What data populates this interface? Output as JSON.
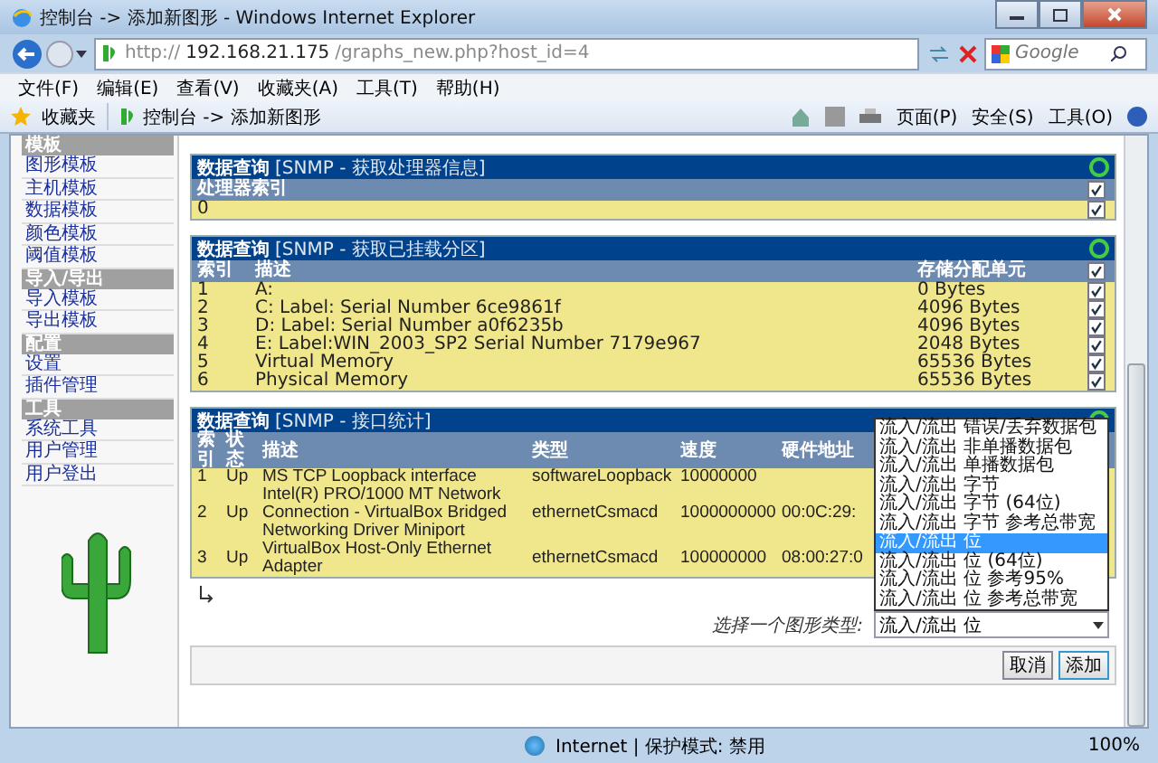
{
  "window": {
    "title": "控制台 -> 添加新图形 - Windows Internet Explorer"
  },
  "address": {
    "scheme": "http://",
    "host": "192.168.21.175",
    "path": "/graphs_new.php?host_id=4"
  },
  "search": {
    "placeholder": "Google"
  },
  "menu": [
    "文件(F)",
    "编辑(E)",
    "查看(V)",
    "收藏夹(A)",
    "工具(T)",
    "帮助(H)"
  ],
  "favorites": {
    "label": "收藏夹",
    "tab": "控制台 -> 添加新图形"
  },
  "toolbar": [
    "页面(P)",
    "安全(S)",
    "工具(O)"
  ],
  "sidebar": [
    {
      "header": "模板",
      "items": [
        "图形模板",
        "主机模板",
        "数据模板",
        "颜色模板",
        "阈值模板"
      ]
    },
    {
      "header": "导入/导出",
      "items": [
        "导入模板",
        "导出模板"
      ]
    },
    {
      "header": "配置",
      "items": [
        "设置",
        "插件管理"
      ]
    },
    {
      "header": "工具",
      "items": [
        "系统工具",
        "用户管理",
        "用户登出"
      ]
    }
  ],
  "panels": [
    {
      "title": "数据查询",
      "subtitle": "[SNMP - 获取处理器信息]",
      "columns": [
        "处理器索引"
      ],
      "header_checked": true,
      "rows": [
        {
          "cells": [
            "0"
          ],
          "checked": true
        }
      ]
    },
    {
      "title": "数据查询",
      "subtitle": "[SNMP - 获取已挂载分区]",
      "columns": [
        "索引",
        "描述",
        "存储分配单元"
      ],
      "header_checked": true,
      "rows": [
        {
          "cells": [
            "1",
            "A:",
            "0 Bytes"
          ],
          "checked": true
        },
        {
          "cells": [
            "2",
            "C: Label: Serial Number 6ce9861f",
            "4096 Bytes"
          ],
          "checked": true
        },
        {
          "cells": [
            "3",
            "D: Label: Serial Number a0f6235b",
            "4096 Bytes"
          ],
          "checked": true
        },
        {
          "cells": [
            "4",
            "E: Label:WIN_2003_SP2 Serial Number 7179e967",
            "2048 Bytes"
          ],
          "checked": true
        },
        {
          "cells": [
            "5",
            "Virtual Memory",
            "65536 Bytes"
          ],
          "checked": true
        },
        {
          "cells": [
            "6",
            "Physical Memory",
            "65536 Bytes"
          ],
          "checked": true
        }
      ]
    },
    {
      "title": "数据查询",
      "subtitle": "[SNMP - 接口统计]",
      "columns": [
        "索引",
        "状态",
        "描述",
        "类型",
        "速度",
        "硬件地址"
      ],
      "rows": [
        {
          "cells": [
            "1",
            "Up",
            "MS TCP Loopback interface",
            "softwareLoopback",
            "10000000",
            ""
          ]
        },
        {
          "cells": [
            "2",
            "Up",
            "Intel(R) PRO/1000 MT Network Connection - VirtualBox Bridged Networking Driver Miniport",
            "ethernetCsmacd",
            "1000000000",
            "00:0C:29:"
          ]
        },
        {
          "cells": [
            "3",
            "Up",
            "VirtualBox Host-Only Ethernet Adapter",
            "ethernetCsmacd",
            "100000000",
            "08:00:27:0"
          ]
        }
      ]
    }
  ],
  "graph_type": {
    "label": "选择一个图形类型:",
    "value": "流入/流出 位",
    "options": [
      {
        "label": "流入/流出 错误/丢弃数据包",
        "selected": false
      },
      {
        "label": "流入/流出 非单播数据包",
        "selected": false
      },
      {
        "label": "流入/流出 单播数据包",
        "selected": false
      },
      {
        "label": "流入/流出 字节",
        "selected": false
      },
      {
        "label": "流入/流出 字节 (64位)",
        "selected": false
      },
      {
        "label": "流入/流出 字节 参考总带宽",
        "selected": false
      },
      {
        "label": "流入/流出 位",
        "selected": true
      },
      {
        "label": "流入/流出 位 (64位)",
        "selected": false
      },
      {
        "label": "流入/流出 位 参考95%",
        "selected": false
      },
      {
        "label": "流入/流出 位 参考总带宽",
        "selected": false
      }
    ]
  },
  "buttons": [
    "取消",
    "添加"
  ],
  "status_bar": {
    "zone": "Internet | 保护模式: 禁用",
    "zoom": "100%"
  }
}
